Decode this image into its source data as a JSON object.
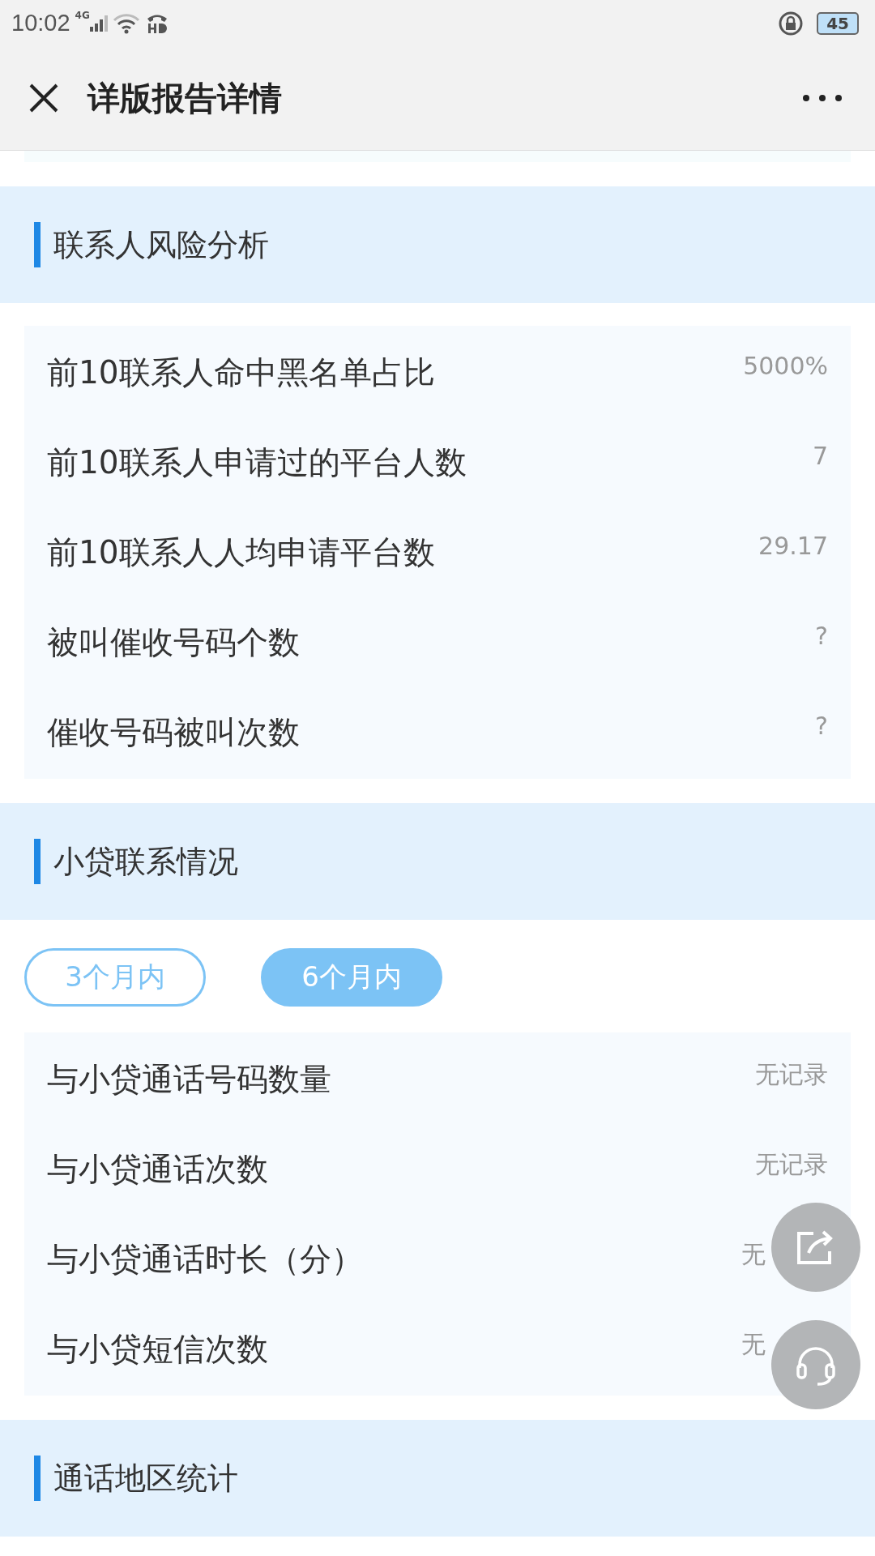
{
  "status_bar": {
    "time": "10:02",
    "network": "4G",
    "battery": "45"
  },
  "header": {
    "title": "详版报告详情"
  },
  "sections": [
    {
      "title": "联系人风险分析",
      "rows": [
        {
          "label": "前10联系人命中黑名单占比",
          "value": "5000%"
        },
        {
          "label": "前10联系人申请过的平台人数",
          "value": "7"
        },
        {
          "label": "前10联系人人均申请平台数",
          "value": "29.17"
        },
        {
          "label": "被叫催收号码个数",
          "value": "?"
        },
        {
          "label": "催收号码被叫次数",
          "value": "?"
        }
      ]
    },
    {
      "title": "小贷联系情况",
      "tabs": [
        {
          "label": "3个月内",
          "selected": false
        },
        {
          "label": "6个月内",
          "selected": true
        }
      ],
      "rows": [
        {
          "label": "与小贷通话号码数量",
          "value": "无记录"
        },
        {
          "label": "与小贷通话次数",
          "value": "无记录"
        },
        {
          "label": "与小贷通话时长（分）",
          "value": "无",
          "obscured": true
        },
        {
          "label": "与小贷短信次数",
          "value": "无",
          "obscured": true
        }
      ]
    },
    {
      "title": "通话地区统计"
    }
  ]
}
